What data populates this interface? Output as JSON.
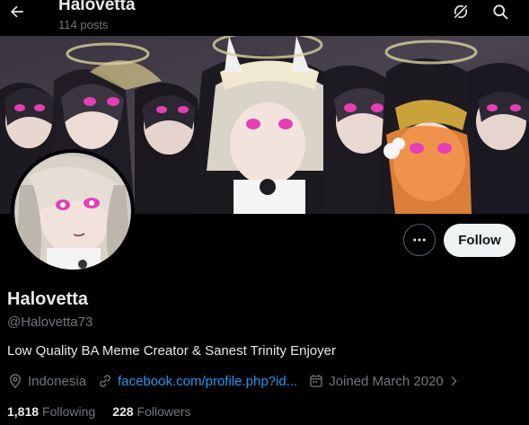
{
  "header": {
    "title": "Halovetta",
    "post_count": "114 posts"
  },
  "profile": {
    "display_name": "Halovetta",
    "handle": "@Halovetta73",
    "bio": "Low Quality BA Meme Creator & Sanest Trinity Enjoyer",
    "location": "Indonesia",
    "website": "facebook.com/profile.php?id...",
    "joined": "Joined March 2020",
    "following_count": "1,818",
    "following_label": "Following",
    "followers_count": "228",
    "followers_label": "Followers"
  },
  "actions": {
    "follow_label": "Follow"
  },
  "icons": {
    "back": "arrow-left-icon",
    "grok": "grok-icon",
    "search": "search-icon",
    "more": "more-dots-icon",
    "location": "location-pin-icon",
    "link": "link-icon",
    "calendar": "calendar-icon",
    "chevron": "chevron-right-icon"
  },
  "colors": {
    "background": "#000000",
    "text_primary": "#e7e9ea",
    "text_secondary": "#71767b",
    "link": "#1d9bf0",
    "follow_button_bg": "#eff3f4",
    "follow_button_text": "#0f1419"
  }
}
